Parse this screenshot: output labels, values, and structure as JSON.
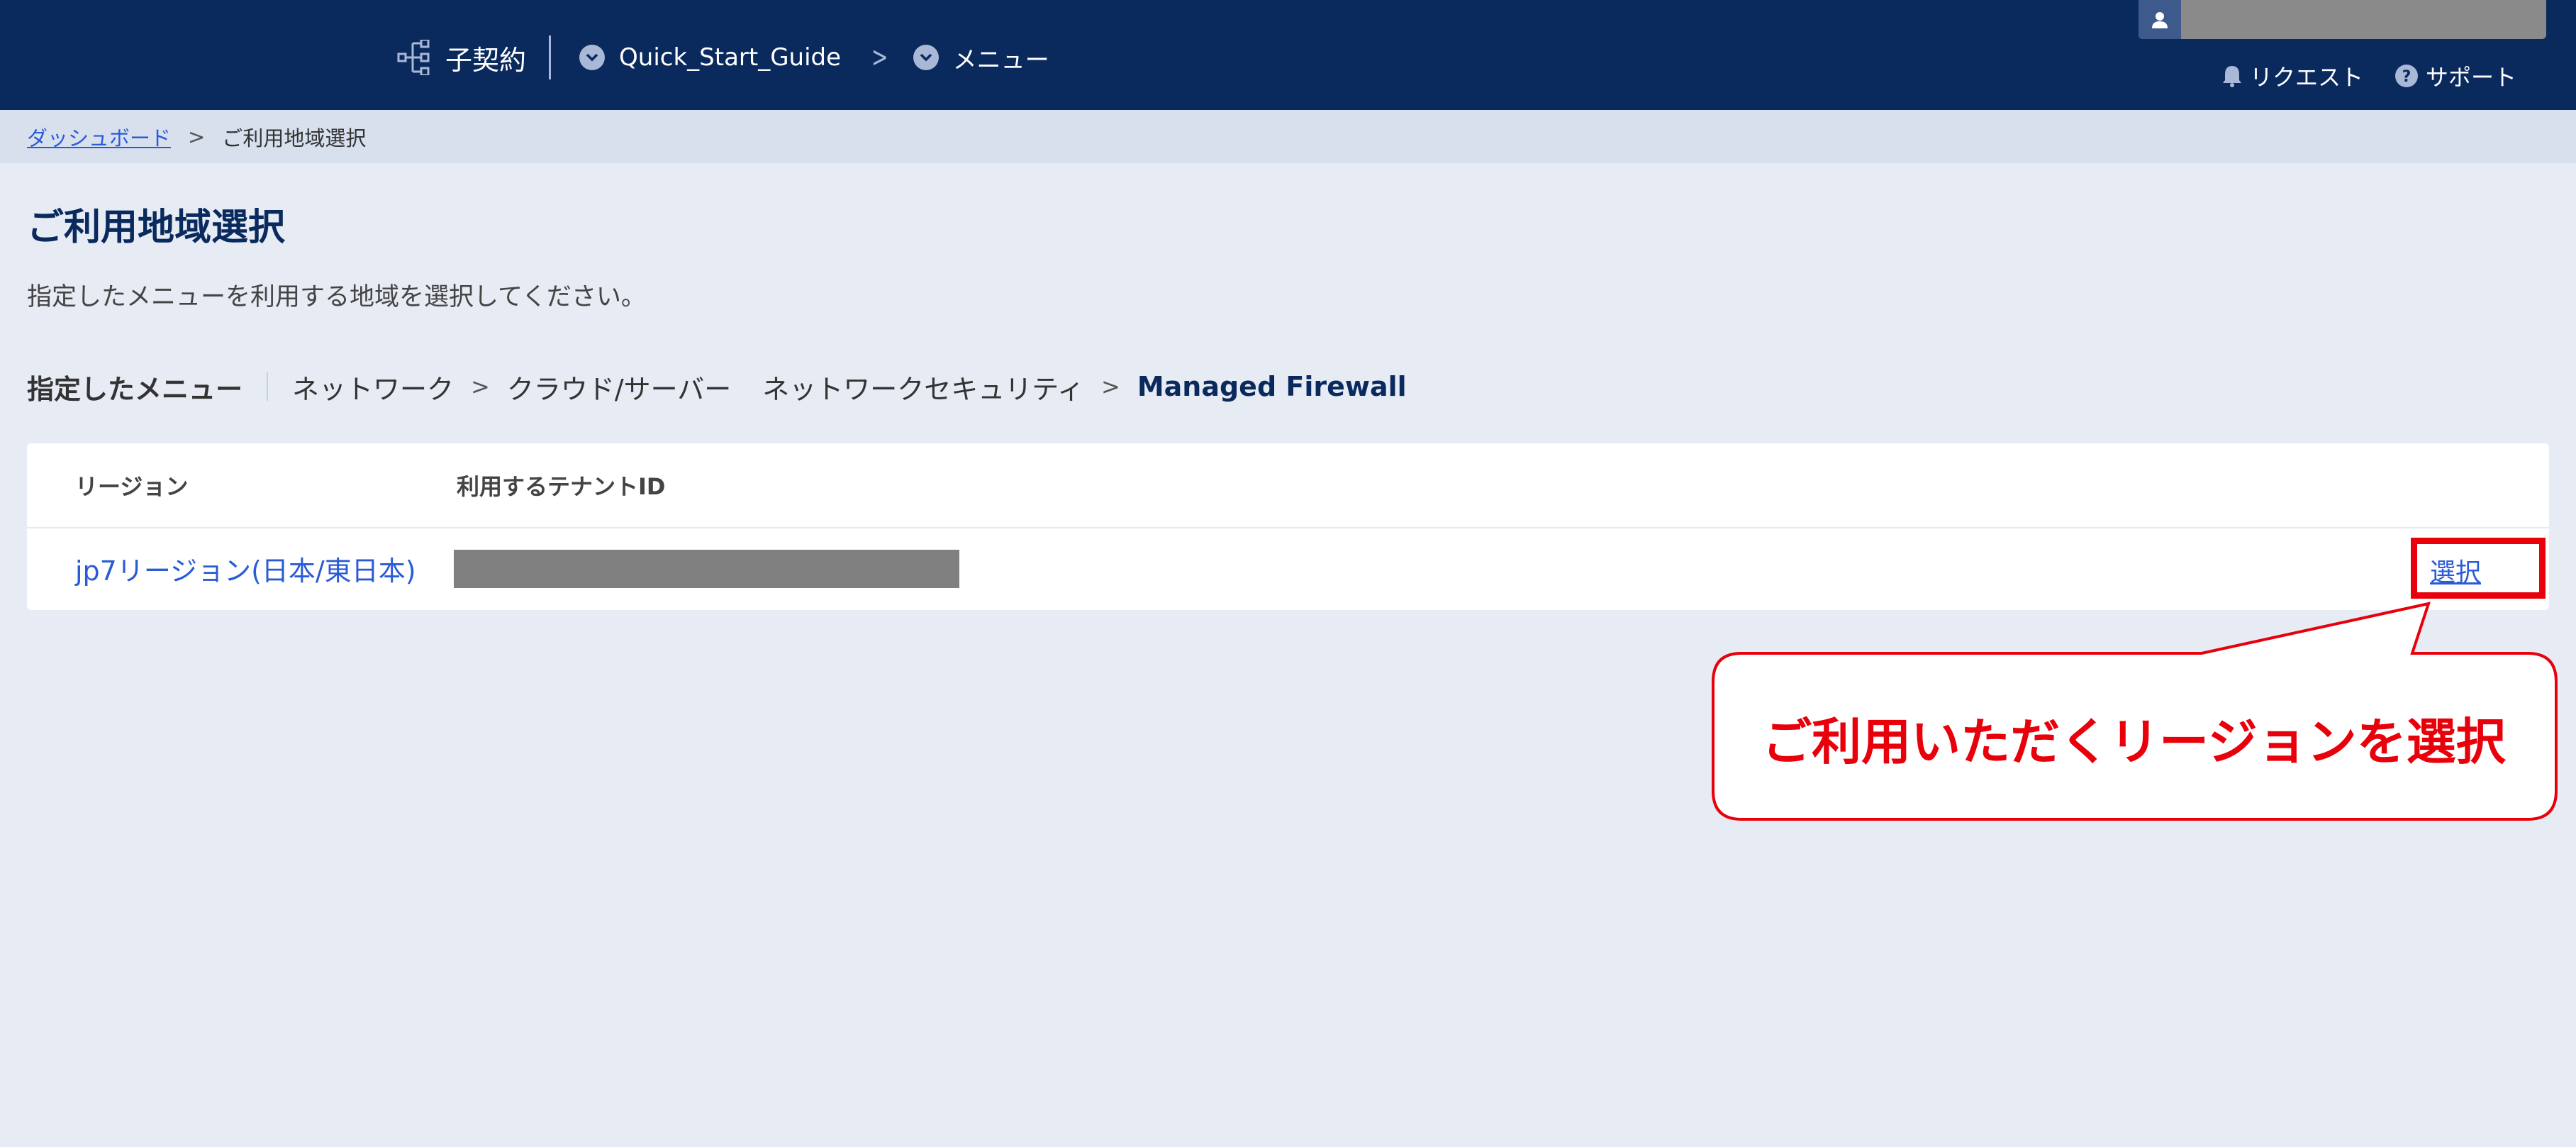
{
  "header": {
    "nav": [
      {
        "label": "子契約",
        "icon": "org-tree-icon"
      },
      {
        "label": "Quick_Start_Guide",
        "icon": "chevron-down-circle-icon"
      },
      {
        "label": "メニュー",
        "icon": "chevron-down-circle-icon"
      }
    ],
    "user_icon": "user-icon",
    "links": [
      {
        "label": "リクエスト",
        "icon": "bell-icon"
      },
      {
        "label": "サポート",
        "icon": "help-circle-icon"
      }
    ]
  },
  "breadcrumb": {
    "home": "ダッシュボード",
    "current": "ご利用地域選択"
  },
  "page": {
    "title": "ご利用地域選択",
    "description": "指定したメニューを利用する地域を選択してください。"
  },
  "menu_path": {
    "label": "指定したメニュー",
    "items": [
      "ネットワーク",
      "クラウド/サーバー",
      "ネットワークセキュリティ",
      "Managed Firewall"
    ]
  },
  "table": {
    "headers": [
      "リージョン",
      "利用するテナントID"
    ],
    "rows": [
      {
        "region": "jp7リージョン(日本/東日本)",
        "action": "選択"
      }
    ]
  },
  "annotation": {
    "text": "ご利用いただくリージョンを選択",
    "color": "#e8000b"
  },
  "colors": {
    "header_bg": "#0a2a5e",
    "link": "#2a5bd7",
    "page_bg": "#e6ebf4"
  }
}
